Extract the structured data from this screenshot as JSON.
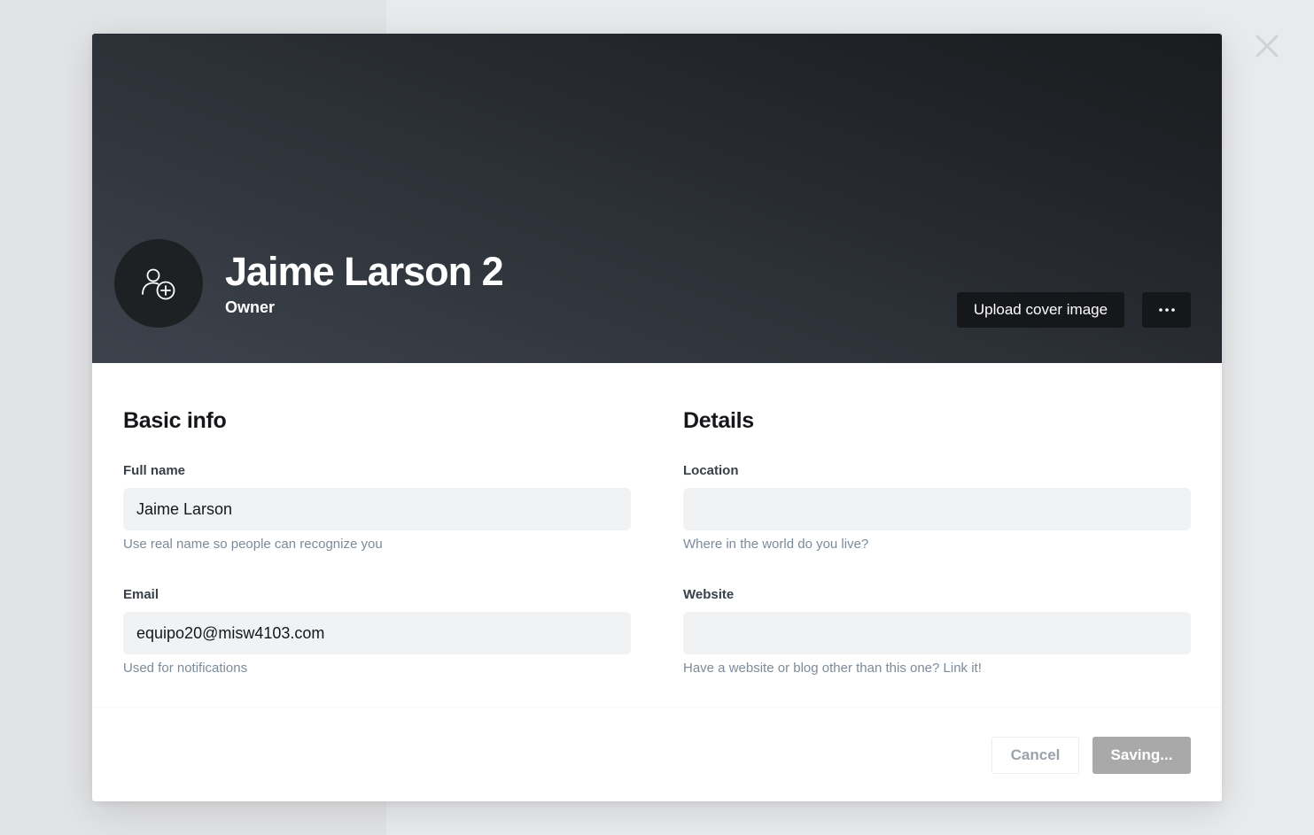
{
  "colors": {
    "cover_dark": "#1a1c1f",
    "cover_light": "#3d434c",
    "button_dark": "#15171a",
    "saving_button": "#a9a9a9",
    "input_bg": "#f1f2f3",
    "hint_text": "#7c8b9a"
  },
  "header": {
    "avatar_icon": "user-add-icon",
    "name": "Jaime Larson 2",
    "role": "Owner",
    "upload_cover_label": "Upload cover image",
    "more_icon": "ellipsis-icon"
  },
  "close_icon": "close-icon",
  "basic_info": {
    "title": "Basic info",
    "full_name": {
      "label": "Full name",
      "value": "Jaime Larson",
      "hint": "Use real name so people can recognize you"
    },
    "email": {
      "label": "Email",
      "value": "equipo20@misw4103.com",
      "hint": "Used for notifications"
    }
  },
  "details": {
    "title": "Details",
    "location": {
      "label": "Location",
      "value": "",
      "hint": "Where in the world do you live?"
    },
    "website": {
      "label": "Website",
      "value": "",
      "hint": "Have a website or blog other than this one? Link it!"
    }
  },
  "footer": {
    "cancel_label": "Cancel",
    "save_label": "Saving..."
  }
}
